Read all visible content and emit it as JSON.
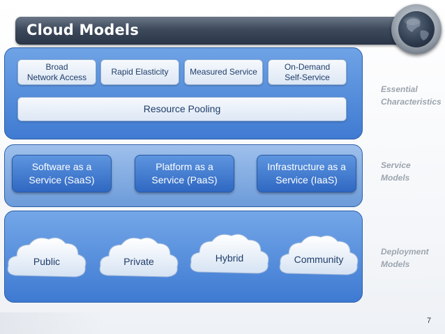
{
  "title": "Cloud Models",
  "essential": {
    "chips": [
      "Broad\nNetwork Access",
      "Rapid Elasticity",
      "Measured Service",
      "On-Demand\nSelf-Service"
    ],
    "pooling": "Resource Pooling",
    "label_line1": "Essential",
    "label_line2": "Characteristics"
  },
  "service": {
    "items": [
      "Software as a\nService (SaaS)",
      "Platform as a\nService (PaaS)",
      "Infrastructure as a\nService (IaaS)"
    ],
    "label_line1": "Service",
    "label_line2": "Models"
  },
  "deployment": {
    "items": [
      "Public",
      "Private",
      "Hybrid",
      "Community"
    ],
    "label_line1": "Deployment",
    "label_line2": "Models"
  },
  "page_number": "7",
  "colors": {
    "panel_dark": "#3f7bd2",
    "panel_light": "#9ec0ec",
    "title_bar": "#2a3647",
    "side_label": "#9aa3ae"
  }
}
